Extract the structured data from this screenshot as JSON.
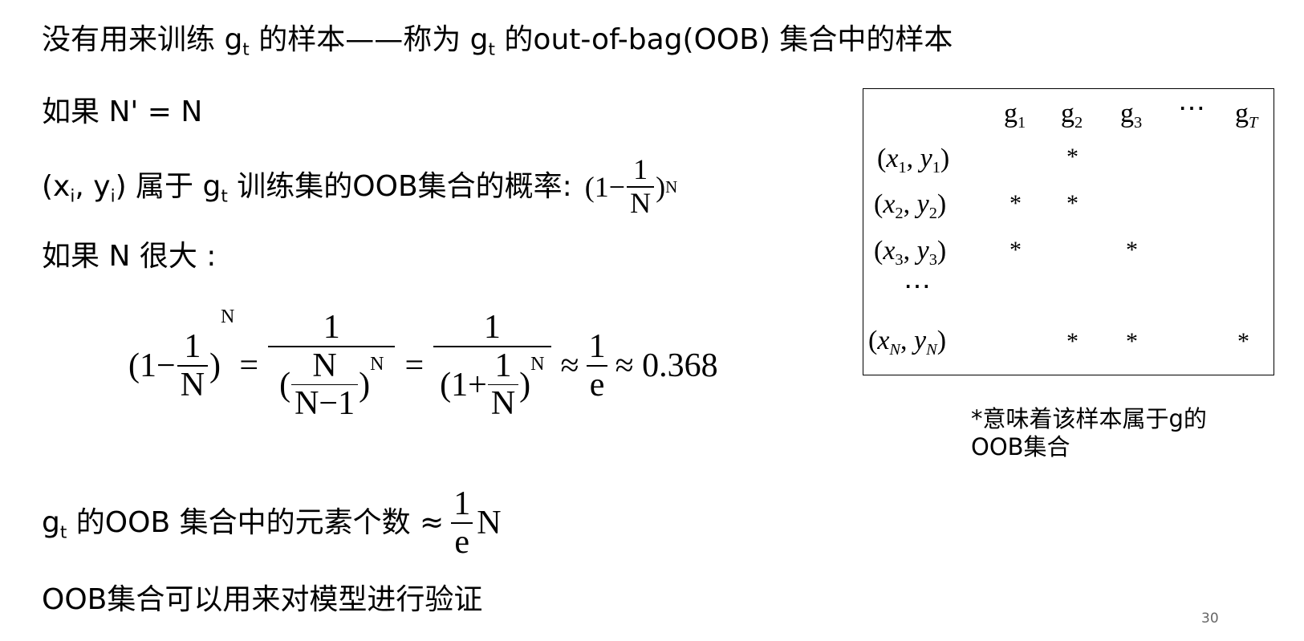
{
  "slide": {
    "line1": {
      "a": "没有用来训练 g",
      "a_sub": "t",
      "b": " 的样本——称为 g",
      "b_sub": "t",
      "c": " 的out-of-bag(OOB) 集合中的样本"
    },
    "line2": "如果 N' = N",
    "line3": {
      "a": "(x",
      "a_sub": "i",
      "b": ", y",
      "b_sub": "i",
      "c": ") 属于 g",
      "c_sub": "t",
      "d": " 训练集的OOB集合的概率:",
      "formula_left": "(1−",
      "formula_num": "1",
      "formula_den": "N",
      "formula_right": ")",
      "formula_exp": "N"
    },
    "line4": "如果 N 很大 :",
    "equation": {
      "t1_left": "(1−",
      "t1_num": "1",
      "t1_den": "N",
      "t1_right": ")",
      "t1_exp": "N",
      "eq1": "=",
      "t2_num": "1",
      "t2_den_left": "(",
      "t2_den_num": "N",
      "t2_den_den": "N−1",
      "t2_den_right": ")",
      "t2_den_exp": "N",
      "eq2": "=",
      "t3_num": "1",
      "t3_den_left": "(1+",
      "t3_den_num": "1",
      "t3_den_den": "N",
      "t3_den_right": ")",
      "t3_den_exp": "N",
      "approx1": "≈",
      "t4_num": "1",
      "t4_den": "e",
      "approx2": "≈ 0.368"
    },
    "line5": {
      "a": "g",
      "a_sub": "t",
      "b": " 的OOB 集合中的元素个数 ≈",
      "frac_num": "1",
      "frac_den": "e",
      "tail": "N"
    },
    "line6": "OOB集合可以用来对模型进行验证",
    "page_number": "30"
  },
  "oob_table": {
    "header": [
      "g",
      "g",
      "g",
      "⋯",
      "g"
    ],
    "header_subs": [
      "1",
      "2",
      "3",
      "",
      "T"
    ],
    "rows": [
      {
        "x": "x",
        "xs": "1",
        "y": "y",
        "ys": "1"
      },
      {
        "x": "x",
        "xs": "2",
        "y": "y",
        "ys": "2"
      },
      {
        "x": "x",
        "xs": "3",
        "y": "y",
        "ys": "3"
      },
      {
        "x": "x",
        "xs": "N",
        "y": "y",
        "ys": "N"
      }
    ],
    "ellipsis": "⋯",
    "star": "*"
  },
  "note": {
    "line1": "*意味着该样本属于g的",
    "line2": "OOB集合"
  }
}
